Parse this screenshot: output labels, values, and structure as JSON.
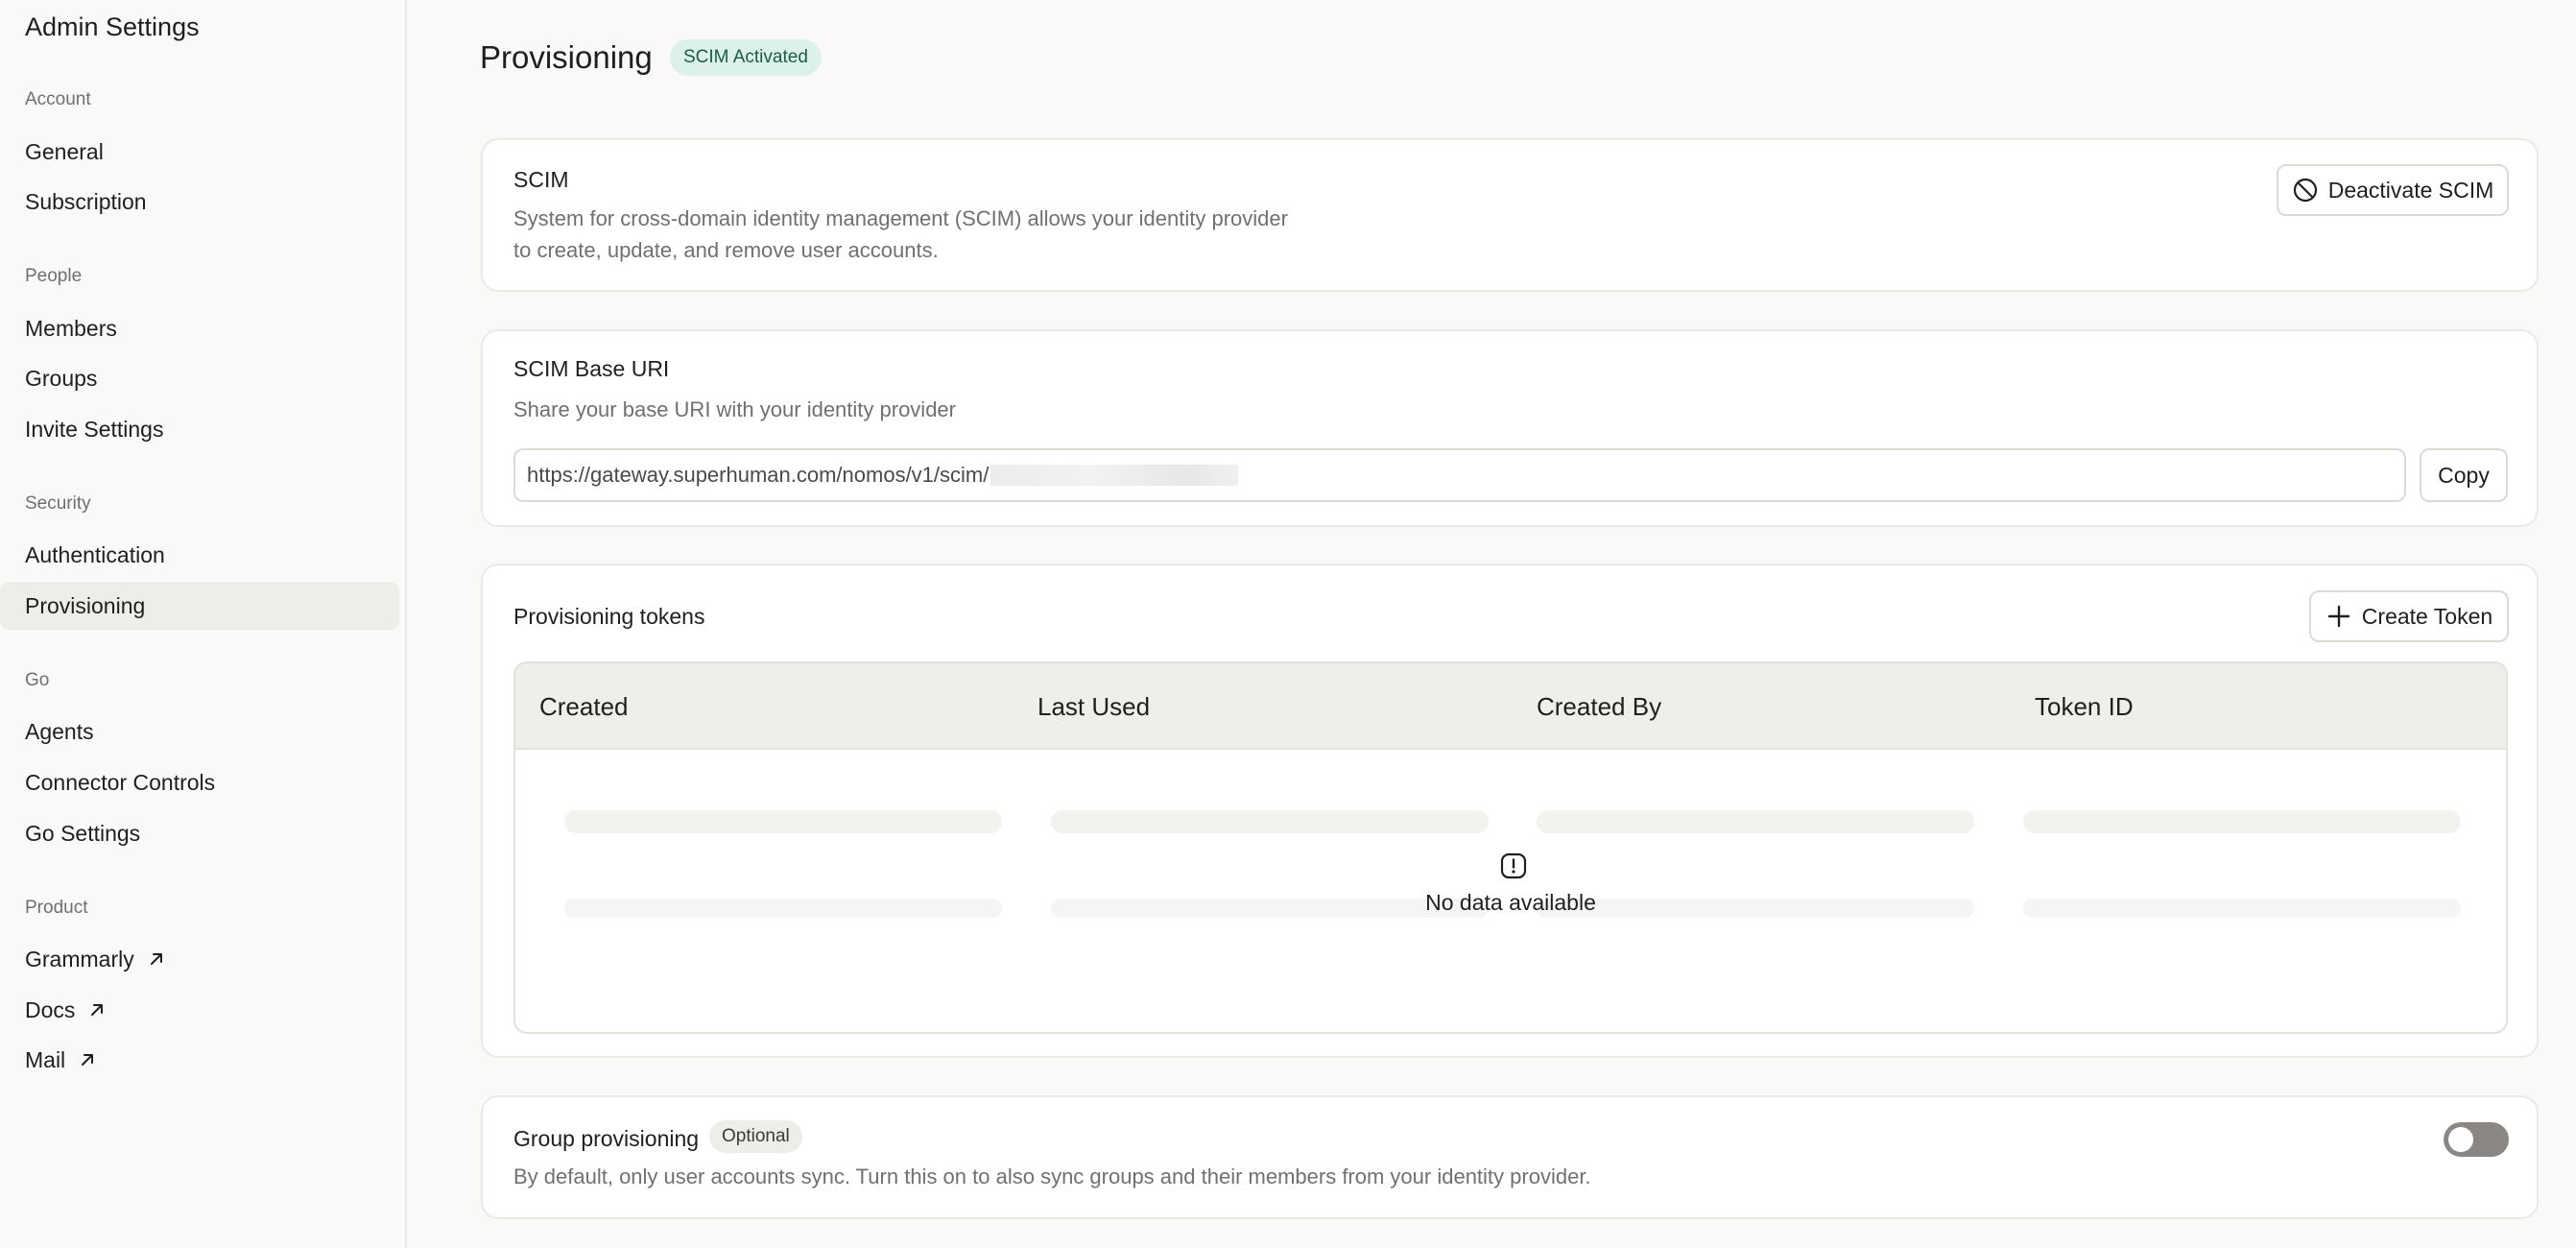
{
  "sidebar": {
    "title": "Admin Settings",
    "sections": [
      {
        "label": "Account",
        "items": [
          "General",
          "Subscription"
        ]
      },
      {
        "label": "People",
        "items": [
          "Members",
          "Groups",
          "Invite Settings"
        ]
      },
      {
        "label": "Security",
        "items": [
          "Authentication",
          "Provisioning"
        ]
      },
      {
        "label": "Go",
        "items": [
          "Agents",
          "Connector Controls",
          "Go Settings"
        ]
      },
      {
        "label": "Product",
        "items": [
          "Grammarly",
          "Docs",
          "Mail"
        ]
      }
    ],
    "active_item": "Provisioning"
  },
  "header": {
    "title": "Provisioning",
    "status_badge": "SCIM Activated"
  },
  "scim_card": {
    "title": "SCIM",
    "description_line1": "System for cross-domain identity management (SCIM) allows your identity provider",
    "description_line2": "to create, update, and remove user accounts.",
    "deactivate_label": "Deactivate SCIM"
  },
  "uri_card": {
    "title": "SCIM Base URI",
    "description": "Share your base URI with your identity provider",
    "uri_value": "https://gateway.superhuman.com/nomos/v1/scim/",
    "copy_label": "Copy"
  },
  "tokens_card": {
    "title": "Provisioning tokens",
    "create_label": "Create Token",
    "columns": [
      "Created",
      "Last Used",
      "Created By",
      "Token ID"
    ],
    "empty_text": "No data available"
  },
  "group_card": {
    "title": "Group provisioning",
    "badge": "Optional",
    "description": "By default, only user accounts sync. Turn this on to also sync groups and their members from your identity provider.",
    "enabled": false
  },
  "colors": {
    "accent_badge_bg": "#dcf1ea",
    "accent_badge_text": "#1c5b4a",
    "toggle_off": "#8a8784"
  }
}
